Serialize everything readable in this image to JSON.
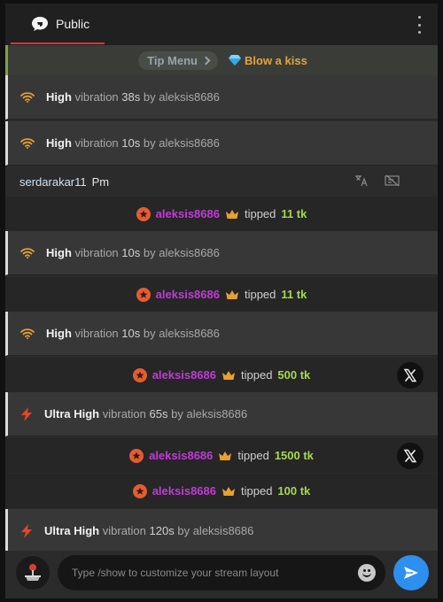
{
  "header": {
    "tab_label": "Public",
    "tab_icon": "chat-bubble-icon",
    "menu_icon": "kebab-menu-icon"
  },
  "tip_menu": {
    "label": "Tip Menu",
    "kiss_label": "Blow a kiss",
    "kiss_icon": "diamond-icon"
  },
  "pm": {
    "user": "serdarakar11",
    "label": "Pm"
  },
  "vib_word": "vibration",
  "by_word": "by",
  "tipped_word": "tipped",
  "messages": [
    {
      "level": "High",
      "duration": "38s",
      "user": "aleksis8686"
    },
    {
      "level": "High",
      "duration": "10s",
      "user": "aleksis8686"
    },
    {
      "user": "aleksis8686",
      "amount": "11 tk"
    },
    {
      "level": "High",
      "duration": "10s",
      "user": "aleksis8686"
    },
    {
      "user": "aleksis8686",
      "amount": "11 tk"
    },
    {
      "level": "High",
      "duration": "10s",
      "user": "aleksis8686"
    },
    {
      "user": "aleksis8686",
      "amount": "500 tk"
    },
    {
      "level": "Ultra High",
      "duration": "65s",
      "user": "aleksis8686"
    },
    {
      "user": "aleksis8686",
      "amount": "1500 tk"
    },
    {
      "user": "aleksis8686",
      "amount": "100 tk"
    },
    {
      "level": "Ultra High",
      "duration": "120s",
      "user": "aleksis8686"
    }
  ],
  "composer": {
    "placeholder": "Type /show to customize your stream layout"
  },
  "colors": {
    "accent_red": "#dd3333",
    "tip_user": "#c13bd6",
    "tip_amount": "#a6d94e",
    "send": "#2d8ff0"
  }
}
